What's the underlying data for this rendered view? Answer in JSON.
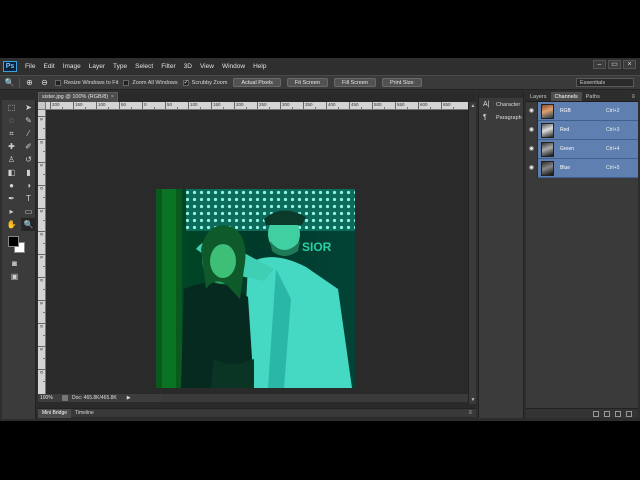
{
  "app": {
    "logo": "Ps",
    "menu": [
      "File",
      "Edit",
      "Image",
      "Layer",
      "Type",
      "Select",
      "Filter",
      "3D",
      "View",
      "Window",
      "Help"
    ],
    "window_controls": [
      "–",
      "▭",
      "×"
    ]
  },
  "options_bar": {
    "checkboxes": [
      {
        "label": "Resize Windows to Fit",
        "checked": false
      },
      {
        "label": "Zoom All Windows",
        "checked": false
      },
      {
        "label": "Scrubby Zoom",
        "checked": true
      }
    ],
    "buttons": [
      "Actual Pixels",
      "Fit Screen",
      "Fill Screen",
      "Print Size"
    ],
    "workspace": "Essentials"
  },
  "document": {
    "tab_title": "sister.jpg @ 100% (RGB/8)",
    "tab_close": "×",
    "zoom": "100%",
    "doc_info": "Doc: 465.8K/465.8K",
    "status_arrow": "▶",
    "photo_sign": "SIOR"
  },
  "rulers": {
    "h_labels": [
      "200",
      "150",
      "100",
      "50",
      "0",
      "50",
      "100",
      "150",
      "200",
      "250",
      "300",
      "350",
      "400",
      "450",
      "500",
      "550",
      "600",
      "650"
    ],
    "v_labels": [
      "5",
      "0",
      "5",
      "0",
      "5",
      "0",
      "5",
      "0",
      "5",
      "0",
      "5",
      "0"
    ]
  },
  "bottom_tabs": [
    "Mini Bridge",
    "Timeline"
  ],
  "dock": [
    {
      "icon": "A|",
      "label": "Character"
    },
    {
      "icon": "¶",
      "label": "Paragraph"
    }
  ],
  "panel": {
    "tabs": [
      "Layers",
      "Channels",
      "Paths"
    ],
    "active_tab": "Channels",
    "channels": [
      {
        "name": "RGB",
        "shortcut": "Ctrl+2"
      },
      {
        "name": "Red",
        "shortcut": "Ctrl+3"
      },
      {
        "name": "Green",
        "shortcut": "Ctrl+4"
      },
      {
        "name": "Blue",
        "shortcut": "Ctrl+5"
      }
    ]
  },
  "colors": {
    "foreground": "#000000",
    "background": "#ffffff",
    "channel_highlight": "#5e7fb0"
  }
}
